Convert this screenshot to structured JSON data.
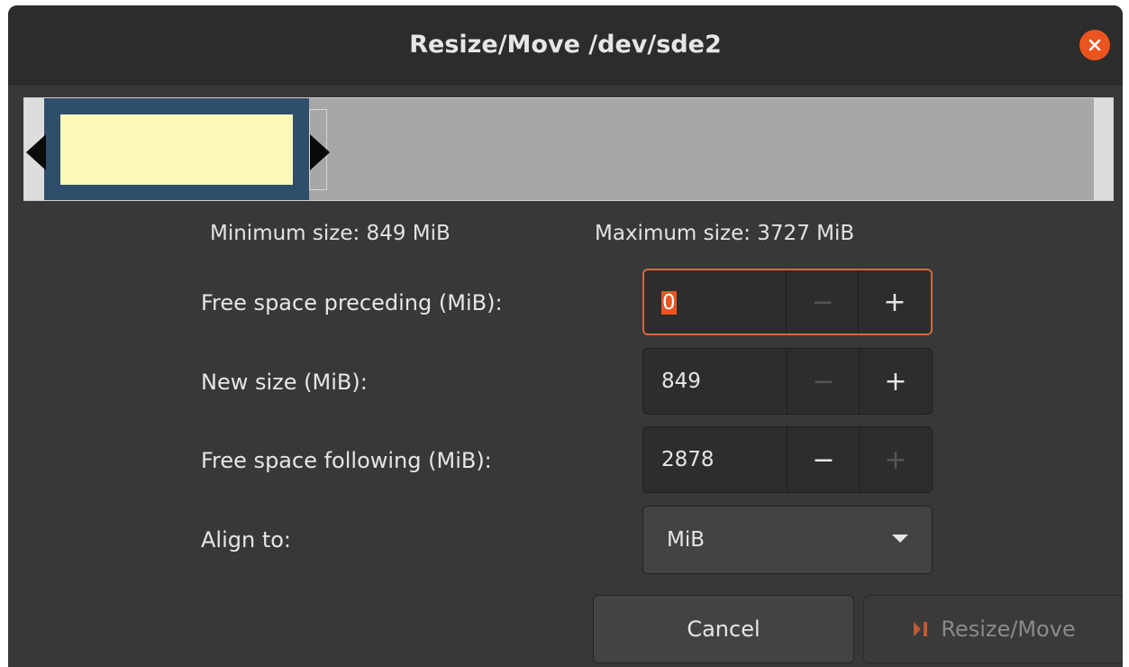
{
  "window": {
    "title": "Resize/Move /dev/sde2"
  },
  "icons": {
    "close": "close-icon",
    "apply": "apply-arrow-icon",
    "dropdown": "chevron-down-icon"
  },
  "colors": {
    "accent": "#e9541f",
    "partition_border": "#2f4e6c",
    "used_space": "#fbf8b8",
    "free_space": "#a7a7a7",
    "focus_ring": "#d06a3c"
  },
  "partition_graphic": {
    "used_fraction": 0.228,
    "partition_fraction": 0.252
  },
  "info": {
    "min_size": "Minimum size: 849 MiB",
    "max_size": "Maximum size: 3727 MiB"
  },
  "fields": {
    "free_preceding": {
      "label": "Free space preceding (MiB):",
      "value": "0",
      "minus_enabled": false,
      "plus_enabled": true,
      "focused": true
    },
    "new_size": {
      "label": "New size (MiB):",
      "value": "849",
      "minus_enabled": false,
      "plus_enabled": true
    },
    "free_following": {
      "label": "Free space following (MiB):",
      "value": "2878",
      "minus_enabled": true,
      "plus_enabled": false
    },
    "align_to": {
      "label": "Align to:",
      "value": "MiB"
    }
  },
  "buttons": {
    "minus": "−",
    "plus": "+",
    "cancel": "Cancel",
    "resize_move": "Resize/Move"
  }
}
